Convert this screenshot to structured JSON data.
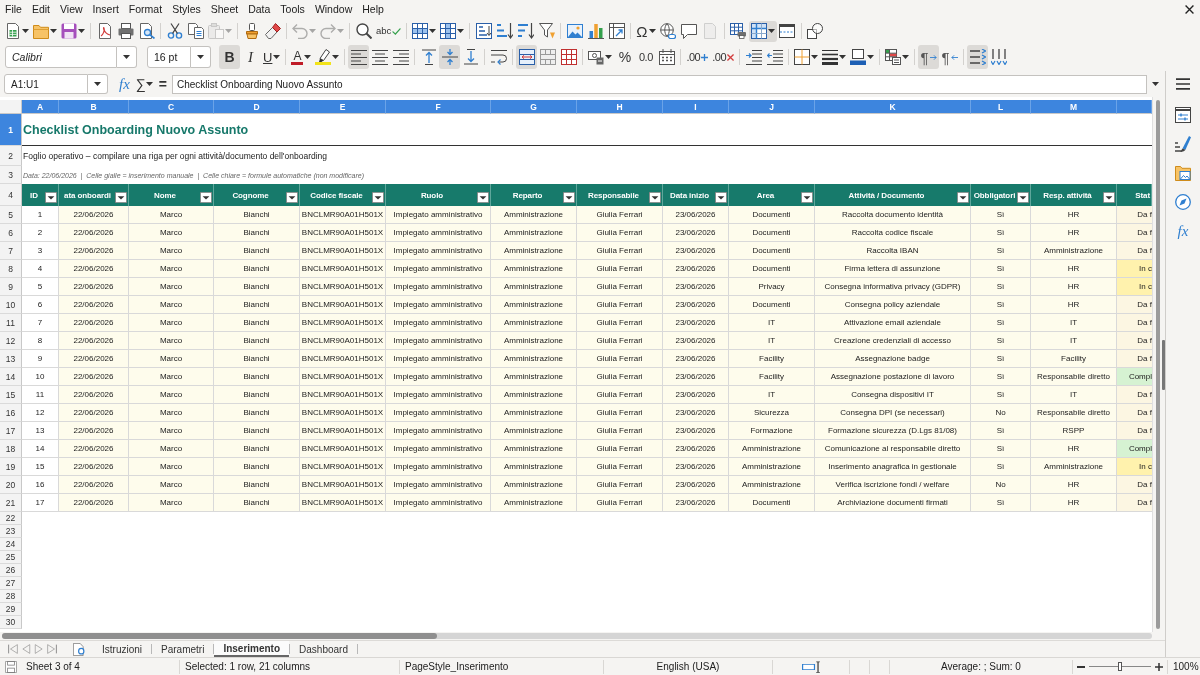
{
  "menu": [
    "File",
    "Edit",
    "View",
    "Insert",
    "Format",
    "Styles",
    "Sheet",
    "Data",
    "Tools",
    "Window",
    "Help"
  ],
  "standard_toolbar": {
    "paste": {
      "disabled": true
    },
    "undo": {
      "disabled": true
    },
    "redo": {
      "disabled": true
    },
    "spelling": {
      "glyph": "abc"
    },
    "special_character": {
      "glyph": "Ω"
    },
    "headers_footers": {
      "disabled": true
    },
    "freeze": {
      "on": true
    }
  },
  "formatting_toolbar": {
    "font_name": "Calibri",
    "font_size": "16 pt",
    "bold": {
      "glyph": "B",
      "on": true
    },
    "italic": {
      "glyph": "I",
      "on": false
    },
    "underline": {
      "glyph": "U",
      "on": false
    },
    "font_color": {
      "glyph": "A"
    },
    "align_left": {
      "on": true
    },
    "align_center": {
      "on": false
    },
    "align_right": {
      "on": false
    },
    "align_top": {
      "on": false
    },
    "align_middle": {
      "on": true
    },
    "align_bottom": {
      "on": false
    },
    "merge_center": {
      "on": true
    },
    "percent": {
      "glyph": "%"
    },
    "number": {
      "glyph": "0.0"
    },
    "add_decimal": {
      "glyph": ".00"
    },
    "delete_decimal": {
      "glyph": ".00"
    },
    "left_to_right": {
      "glyph": "¶",
      "on": true
    },
    "right_to_left": {
      "glyph": "¶",
      "on": false
    },
    "text_direction": {
      "on": true
    },
    "vertical_text": {
      "on": false
    }
  },
  "formula_bar": {
    "name_box": "A1:U1",
    "function_wizard": "fx",
    "sum": "∑",
    "formula": "=",
    "content": "Checklist Onboarding Nuovo Assunto"
  },
  "sheet": {
    "column_headers": [
      {
        "label": "A",
        "selected": true
      },
      {
        "label": "B",
        "selected": true
      },
      {
        "label": "C",
        "selected": true
      },
      {
        "label": "D",
        "selected": true
      },
      {
        "label": "E",
        "selected": true
      },
      {
        "label": "F",
        "selected": true
      },
      {
        "label": "G",
        "selected": true
      },
      {
        "label": "H",
        "selected": true
      },
      {
        "label": "I",
        "selected": true
      },
      {
        "label": "J",
        "selected": true
      },
      {
        "label": "K",
        "selected": true
      },
      {
        "label": "L",
        "selected": true
      },
      {
        "label": "M",
        "selected": true
      }
    ],
    "row_numbers": [
      {
        "label": "1",
        "selected": true
      },
      {
        "label": "2",
        "selected": false
      },
      {
        "label": "3",
        "selected": false
      },
      {
        "label": "4",
        "selected": false
      },
      {
        "label": "5",
        "selected": false
      },
      {
        "label": "6",
        "selected": false
      },
      {
        "label": "7",
        "selected": false
      },
      {
        "label": "8",
        "selected": false
      },
      {
        "label": "9",
        "selected": false
      },
      {
        "label": "10",
        "selected": false
      },
      {
        "label": "11",
        "selected": false
      },
      {
        "label": "12",
        "selected": false
      },
      {
        "label": "13",
        "selected": false
      },
      {
        "label": "14",
        "selected": false
      },
      {
        "label": "15",
        "selected": false
      },
      {
        "label": "16",
        "selected": false
      },
      {
        "label": "17",
        "selected": false
      },
      {
        "label": "18",
        "selected": false
      },
      {
        "label": "19",
        "selected": false
      },
      {
        "label": "20",
        "selected": false
      },
      {
        "label": "21",
        "selected": false
      },
      {
        "label": "22",
        "selected": false
      },
      {
        "label": "23",
        "selected": false
      },
      {
        "label": "24",
        "selected": false
      },
      {
        "label": "25",
        "selected": false
      },
      {
        "label": "26",
        "selected": false
      },
      {
        "label": "27",
        "selected": false
      },
      {
        "label": "28",
        "selected": false
      },
      {
        "label": "29",
        "selected": false
      },
      {
        "label": "30",
        "selected": false
      }
    ],
    "title": "Checklist Onboarding Nuovo Assunto",
    "subtitle": "Foglio operativo – compilare una riga per ogni attività/documento dell'onboarding",
    "note": "Data: 22/06/2026  |  Celle gialle = inserimento manuale  |  Celle chiare = formule automatiche (non modificare)",
    "columns": [
      {
        "label": "ID",
        "filter": true
      },
      {
        "label": "ata onboardi",
        "filter": true
      },
      {
        "label": "Nome",
        "filter": true
      },
      {
        "label": "Cognome",
        "filter": true
      },
      {
        "label": "Codice fiscale",
        "filter": true
      },
      {
        "label": "Ruolo",
        "filter": true
      },
      {
        "label": "Reparto",
        "filter": true
      },
      {
        "label": "Responsabile",
        "filter": true
      },
      {
        "label": "Data inizio",
        "filter": true
      },
      {
        "label": "Area",
        "filter": true
      },
      {
        "label": "Attività / Documento",
        "filter": true
      },
      {
        "label": "Obbligatori",
        "filter": true
      },
      {
        "label": "Resp. attività",
        "filter": true
      },
      {
        "label": "Stat",
        "filter": false
      }
    ],
    "rows": [
      {
        "cells": [
          "1",
          "22/06/2026",
          "Marco",
          "Bianchi",
          "BNCLMR90A01H501X",
          "Impiegato amministrativo",
          "Amministrazione",
          "Giulia Ferrari",
          "23/06/2026",
          "Documenti",
          "Raccolta documento identità",
          "Sì",
          "HR"
        ],
        "status": {
          "text": "Da f",
          "color": "#fcf6e2"
        }
      },
      {
        "cells": [
          "2",
          "22/06/2026",
          "Marco",
          "Bianchi",
          "BNCLMR90A01H501X",
          "Impiegato amministrativo",
          "Amministrazione",
          "Giulia Ferrari",
          "23/06/2026",
          "Documenti",
          "Raccolta codice fiscale",
          "Sì",
          "HR"
        ],
        "status": {
          "text": "Da f",
          "color": "#fcf6e2"
        }
      },
      {
        "cells": [
          "3",
          "22/06/2026",
          "Marco",
          "Bianchi",
          "BNCLMR90A01H501X",
          "Impiegato amministrativo",
          "Amministrazione",
          "Giulia Ferrari",
          "23/06/2026",
          "Documenti",
          "Raccolta IBAN",
          "Sì",
          "Amministrazione"
        ],
        "status": {
          "text": "Da f",
          "color": "#fcf6e2"
        }
      },
      {
        "cells": [
          "4",
          "22/06/2026",
          "Marco",
          "Bianchi",
          "BNCLMR90A01H501X",
          "Impiegato amministrativo",
          "Amministrazione",
          "Giulia Ferrari",
          "23/06/2026",
          "Documenti",
          "Firma lettera di assunzione",
          "Sì",
          "HR"
        ],
        "status": {
          "text": "In c",
          "color": "#fff2ad"
        }
      },
      {
        "cells": [
          "5",
          "22/06/2026",
          "Marco",
          "Bianchi",
          "BNCLMR90A01H501X",
          "Impiegato amministrativo",
          "Amministrazione",
          "Giulia Ferrari",
          "23/06/2026",
          "Privacy",
          "Consegna informativa privacy (GDPR)",
          "Sì",
          "HR"
        ],
        "status": {
          "text": "In c",
          "color": "#fff2ad"
        }
      },
      {
        "cells": [
          "6",
          "22/06/2026",
          "Marco",
          "Bianchi",
          "BNCLMR90A01H501X",
          "Impiegato amministrativo",
          "Amministrazione",
          "Giulia Ferrari",
          "23/06/2026",
          "Documenti",
          "Consegna policy aziendale",
          "Sì",
          "HR"
        ],
        "status": {
          "text": "Da f",
          "color": "#fcf6e2"
        }
      },
      {
        "cells": [
          "7",
          "22/06/2026",
          "Marco",
          "Bianchi",
          "BNCLMR90A01H501X",
          "Impiegato amministrativo",
          "Amministrazione",
          "Giulia Ferrari",
          "23/06/2026",
          "IT",
          "Attivazione email aziendale",
          "Sì",
          "IT"
        ],
        "status": {
          "text": "Da f",
          "color": "#fcf6e2"
        }
      },
      {
        "cells": [
          "8",
          "22/06/2026",
          "Marco",
          "Bianchi",
          "BNCLMR90A01H501X",
          "Impiegato amministrativo",
          "Amministrazione",
          "Giulia Ferrari",
          "23/06/2026",
          "IT",
          "Creazione credenziali di accesso",
          "Sì",
          "IT"
        ],
        "status": {
          "text": "Da f",
          "color": "#fcf6e2"
        }
      },
      {
        "cells": [
          "9",
          "22/06/2026",
          "Marco",
          "Bianchi",
          "BNCLMR90A01H501X",
          "Impiegato amministrativo",
          "Amministrazione",
          "Giulia Ferrari",
          "23/06/2026",
          "Facility",
          "Assegnazione badge",
          "Sì",
          "Facility"
        ],
        "status": {
          "text": "Da f",
          "color": "#fcf6e2"
        }
      },
      {
        "cells": [
          "10",
          "22/06/2026",
          "Marco",
          "Bianchi",
          "BNCLMR90A01H501X",
          "Impiegato amministrativo",
          "Amministrazione",
          "Giulia Ferrari",
          "23/06/2026",
          "Facility",
          "Assegnazione postazione di lavoro",
          "Sì",
          "Responsabile diretto"
        ],
        "status": {
          "text": "Compl",
          "color": "#d6f2d2"
        }
      },
      {
        "cells": [
          "11",
          "22/06/2026",
          "Marco",
          "Bianchi",
          "BNCLMR90A01H501X",
          "Impiegato amministrativo",
          "Amministrazione",
          "Giulia Ferrari",
          "23/06/2026",
          "IT",
          "Consegna dispositivi IT",
          "Sì",
          "IT"
        ],
        "status": {
          "text": "Da f",
          "color": "#fcf6e2"
        }
      },
      {
        "cells": [
          "12",
          "22/06/2026",
          "Marco",
          "Bianchi",
          "BNCLMR90A01H501X",
          "Impiegato amministrativo",
          "Amministrazione",
          "Giulia Ferrari",
          "23/06/2026",
          "Sicurezza",
          "Consegna DPI (se necessari)",
          "No",
          "Responsabile diretto"
        ],
        "status": {
          "text": "Da f",
          "color": "#fcf6e2"
        }
      },
      {
        "cells": [
          "13",
          "22/06/2026",
          "Marco",
          "Bianchi",
          "BNCLMR90A01H501X",
          "Impiegato amministrativo",
          "Amministrazione",
          "Giulia Ferrari",
          "23/06/2026",
          "Formazione",
          "Formazione sicurezza (D.Lgs 81/08)",
          "Sì",
          "RSPP"
        ],
        "status": {
          "text": "Da f",
          "color": "#fcf6e2"
        }
      },
      {
        "cells": [
          "14",
          "22/06/2026",
          "Marco",
          "Bianchi",
          "BNCLMR90A01H501X",
          "Impiegato amministrativo",
          "Amministrazione",
          "Giulia Ferrari",
          "23/06/2026",
          "Amministrazione",
          "Comunicazione al responsabile diretto",
          "Sì",
          "HR"
        ],
        "status": {
          "text": "Compl",
          "color": "#d6f2d2"
        }
      },
      {
        "cells": [
          "15",
          "22/06/2026",
          "Marco",
          "Bianchi",
          "BNCLMR90A01H501X",
          "Impiegato amministrativo",
          "Amministrazione",
          "Giulia Ferrari",
          "23/06/2026",
          "Amministrazione",
          "Inserimento anagrafica in gestionale",
          "Sì",
          "Amministrazione"
        ],
        "status": {
          "text": "In c",
          "color": "#fff2ad"
        }
      },
      {
        "cells": [
          "16",
          "22/06/2026",
          "Marco",
          "Bianchi",
          "BNCLMR90A01H501X",
          "Impiegato amministrativo",
          "Amministrazione",
          "Giulia Ferrari",
          "23/06/2026",
          "Amministrazione",
          "Verifica iscrizione fondi / welfare",
          "No",
          "HR"
        ],
        "status": {
          "text": "Da f",
          "color": "#fcf6e2"
        }
      },
      {
        "cells": [
          "17",
          "22/06/2026",
          "Marco",
          "Bianchi",
          "BNCLMR90A01H501X",
          "Impiegato amministrativo",
          "Amministrazione",
          "Giulia Ferrari",
          "23/06/2026",
          "Documenti",
          "Archiviazione documenti firmati",
          "Sì",
          "HR"
        ],
        "status": {
          "text": "Da f",
          "color": "#fcf6e2"
        }
      }
    ]
  },
  "sheet_tabs": [
    {
      "label": "Istruzioni",
      "selected": false
    },
    {
      "label": "Parametri",
      "selected": false
    },
    {
      "label": "Inserimento",
      "selected": true
    },
    {
      "label": "Dashboard",
      "selected": false
    }
  ],
  "sidebar": {
    "functions": "fx"
  },
  "status_bar": {
    "sheet": "Sheet 3 of 4",
    "selection": "Selected: 1 row, 21 columns",
    "page_style": "PageStyle_Inserimento",
    "language": "English (USA)",
    "summary": "Average: ; Sum: 0",
    "zoom_slider": {
      "level": 0.5
    },
    "zoom": "100%"
  }
}
